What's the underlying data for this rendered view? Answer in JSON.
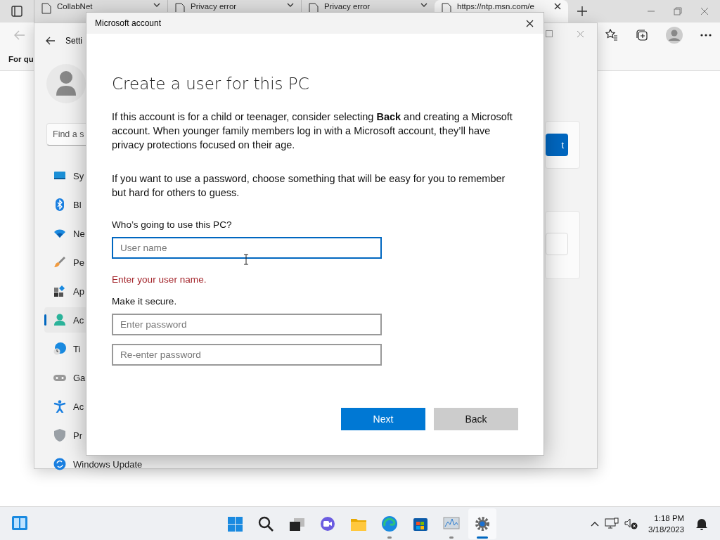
{
  "browser": {
    "tabs": [
      {
        "title": "CollabNet",
        "selected": false
      },
      {
        "title": "Privacy error",
        "selected": false
      },
      {
        "title": "Privacy error",
        "selected": false
      },
      {
        "title": "https://ntp.msn.com/e",
        "selected": true
      }
    ],
    "favorites_bar": {
      "text": "For qu"
    }
  },
  "settings": {
    "title": "Setti",
    "search": {
      "placeholder": "Find a s"
    },
    "nav": [
      {
        "label": "Sy",
        "selected": false
      },
      {
        "label": "Bl",
        "selected": false
      },
      {
        "label": "Ne",
        "selected": false
      },
      {
        "label": "Pe",
        "selected": false
      },
      {
        "label": "Ap",
        "selected": false
      },
      {
        "label": "Ac",
        "selected": true
      },
      {
        "label": "Ti",
        "selected": false
      },
      {
        "label": "Ga",
        "selected": false
      },
      {
        "label": "Ac",
        "selected": false
      },
      {
        "label": "Pr",
        "selected": false
      },
      {
        "label": "Windows Update",
        "selected": false
      }
    ],
    "content_button": "t"
  },
  "dialog": {
    "title": "Microsoft account",
    "heading": "Create a user for this PC",
    "paragraphs": [
      "If this account is for a child or teenager, consider selecting **Back** and creating a Microsoft account. When younger family members log in with a Microsoft account, they’ll have privacy protections focused on their age.",
      "If you want to use a password, choose something that will be easy for you to remember but hard for others to guess."
    ],
    "user_label": "Who’s going to use this PC?",
    "user_field": {
      "placeholder": "User name",
      "focused": true
    },
    "error": "Enter your user name.",
    "secure_label": "Make it secure.",
    "password_fields": [
      {
        "placeholder": "Enter password",
        "focused": false
      },
      {
        "placeholder": "Re-enter password",
        "focused": false
      }
    ],
    "buttons": [
      {
        "label": "Next",
        "kind": "primary"
      },
      {
        "label": "Back",
        "kind": "secondary"
      }
    ]
  },
  "taskbar": {
    "apps": [
      {
        "running": false,
        "active": false
      },
      {
        "running": false,
        "active": false
      },
      {
        "running": false,
        "active": false
      },
      {
        "running": false,
        "active": false
      },
      {
        "running": false,
        "active": false
      },
      {
        "running": true,
        "active": false
      },
      {
        "running": false,
        "active": false
      },
      {
        "running": true,
        "active": false
      },
      {
        "running": true,
        "active": true
      }
    ],
    "time": "1:18 PM",
    "date": "3/18/2023"
  }
}
